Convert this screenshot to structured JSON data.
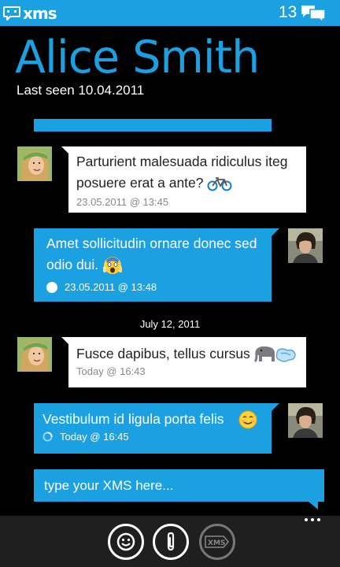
{
  "app": {
    "name": "xms",
    "unread_count": "13"
  },
  "header": {
    "contact_name": "Alice Smith",
    "last_seen": "Last seen 10.04.2011"
  },
  "messages": [
    {
      "direction": "incoming",
      "text": "Parturient malesuada ridiculus iteg posuere erat a ante?",
      "emoji": "bicycle",
      "timestamp": "23.05.2011 @ 13:45"
    },
    {
      "direction": "outgoing",
      "text": "Amet sollicitudin ornare donec sed odio dui.",
      "emoji": "screaming-face",
      "status": "sent",
      "timestamp": "23.05.2011 @ 13:48"
    },
    {
      "direction": "incoming",
      "text": "Fusce dapibus, tellus cursus",
      "emoji": "elephant-dash",
      "timestamp": "Today @ 16:43"
    },
    {
      "direction": "outgoing",
      "text": "Vestibulum id ligula porta felis",
      "emoji": "smiling-face",
      "status": "sending",
      "timestamp": "Today @ 16:45"
    }
  ],
  "date_separator": "July 12, 2011",
  "compose": {
    "placeholder": "type your XMS here..."
  },
  "appbar": {
    "buttons": [
      {
        "name": "emoticons",
        "icon": "smiley-icon",
        "enabled": true
      },
      {
        "name": "attach",
        "icon": "paperclip-icon",
        "enabled": true
      },
      {
        "name": "send",
        "icon": "xms-send-icon",
        "label": "XMS",
        "enabled": false
      }
    ]
  },
  "colors": {
    "accent": "#1ba1e2",
    "background": "#000000",
    "incoming_bubble": "#ffffff",
    "appbar": "#1f1f1f"
  }
}
